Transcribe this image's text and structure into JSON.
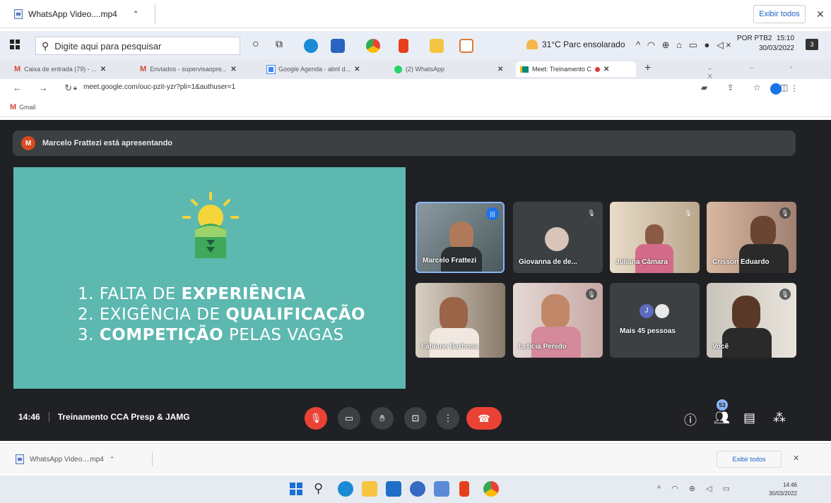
{
  "download_bar_top": {
    "file": "WhatsApp Video....mp4",
    "show_all": "Exibir todos",
    "close": "✕"
  },
  "taskbar_top": {
    "search_placeholder": "Digite aqui para pesquisar",
    "weather": "31°C  Parc ensolarado",
    "lang": "POR\nPTB2",
    "time": "15:10",
    "date": "30/03/2022",
    "notifications": "3"
  },
  "tabs": [
    {
      "label": "Caixa de entrada (79) - ...",
      "icon": "gmail-icon"
    },
    {
      "label": "Enviados - supervisaopre...",
      "icon": "gmail-icon"
    },
    {
      "label": "Google Agenda - abril d...",
      "icon": "calendar-icon"
    },
    {
      "label": "(2) WhatsApp",
      "icon": "whatsapp-icon"
    },
    {
      "label": "Meet: Treinamento C",
      "icon": "meet-icon"
    }
  ],
  "address": {
    "url": "meet.google.com/ouc-pzit-yzr?pli=1&authuser=1"
  },
  "bookmarks": {
    "gmail": "Gmail"
  },
  "meet": {
    "presenting": "Marcelo Frattezi está apresentando",
    "presenter_initial": "M",
    "slide": {
      "items": [
        {
          "n": "1.",
          "pre": "FALTA DE ",
          "bold": "EXPERIÊNCIA",
          "post": ""
        },
        {
          "n": "2.",
          "pre": "EXIGÊNCIA DE ",
          "bold": "QUALIFICAÇÃO",
          "post": ""
        },
        {
          "n": "3.",
          "pre": "",
          "bold": "COMPETIÇÃO",
          "post": " PELAS VAGAS"
        }
      ]
    },
    "participants": [
      {
        "name": "Marcelo Frattezi"
      },
      {
        "name": "Giovanna de de..."
      },
      {
        "name": "Juliana Câmara"
      },
      {
        "name": "Crisson Eduardo"
      },
      {
        "name": "Fabiane Barbosa"
      },
      {
        "name": "Leticia Penido"
      },
      {
        "name": "Mais 45 pessoas",
        "initial": "J"
      },
      {
        "name": "Você"
      }
    ],
    "time": "14:46",
    "meeting_name": "Treinamento CCA Presp & JAMG",
    "people_count": "53"
  },
  "download_bar_bottom": {
    "file": "WhatsApp Video....mp4",
    "show_all": "Exibir todos"
  },
  "taskbar_bottom": {
    "time": "14:46",
    "date": "30/03/2022"
  },
  "colors": {
    "meet_bg": "#202124",
    "slide_bg": "#5db8b0",
    "end_call": "#ea4335",
    "accent": "#1a73e8"
  }
}
